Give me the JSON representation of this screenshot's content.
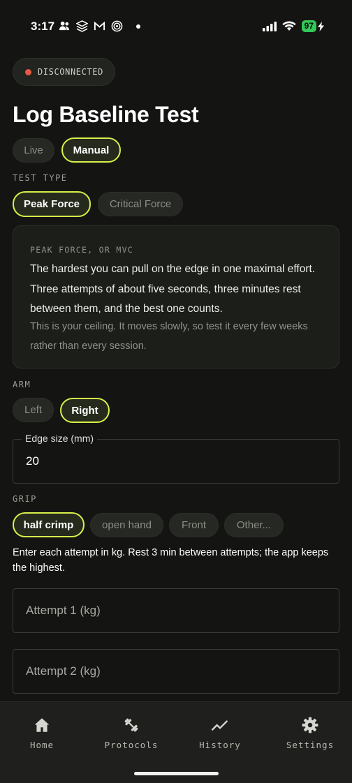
{
  "status_bar": {
    "time": "3:17",
    "app_icons": [
      "users-icon",
      "layers-icon",
      "gmail-icon",
      "target-icon",
      "dot-icon"
    ],
    "battery_level": "97",
    "battery_color": "#34c759"
  },
  "connection": {
    "status": "DISCONNECTED",
    "dot_color": "#e45a47"
  },
  "page_title": "Log Baseline Test",
  "mode_tabs": [
    {
      "label": "Live",
      "selected": false
    },
    {
      "label": "Manual",
      "selected": true
    }
  ],
  "test_type": {
    "label": "TEST TYPE",
    "options": [
      {
        "label": "Peak Force",
        "selected": true
      },
      {
        "label": "Critical Force",
        "selected": false
      }
    ]
  },
  "info_card": {
    "title": "PEAK FORCE, OR MVC",
    "main": "The hardest you can pull on the edge in one maximal effort. Three attempts of about five seconds, three minutes rest between them, and the best one counts.",
    "sub": "This is your ceiling. It moves slowly, so test it every few weeks rather than every session."
  },
  "arm": {
    "label": "ARM",
    "options": [
      {
        "label": "Left",
        "selected": false
      },
      {
        "label": "Right",
        "selected": true
      }
    ]
  },
  "edge_size": {
    "label": "Edge size (mm)",
    "value": "20"
  },
  "grip": {
    "label": "GRIP",
    "options": [
      {
        "label": "half crimp",
        "selected": true
      },
      {
        "label": "open hand",
        "selected": false
      },
      {
        "label": "Front",
        "selected": false
      },
      {
        "label": "Other...",
        "selected": false
      }
    ]
  },
  "instructions": "Enter each attempt in kg. Rest 3 min between attempts; the app keeps the highest.",
  "attempts": [
    {
      "placeholder": "Attempt 1 (kg)"
    },
    {
      "placeholder": "Attempt 2 (kg)"
    }
  ],
  "nav": [
    {
      "label": "Home",
      "icon": "home-icon"
    },
    {
      "label": "Protocols",
      "icon": "dumbbell-icon"
    },
    {
      "label": "History",
      "icon": "trend-line-icon"
    },
    {
      "label": "Settings",
      "icon": "gear-icon"
    }
  ],
  "accent_color": "#d8f04a"
}
